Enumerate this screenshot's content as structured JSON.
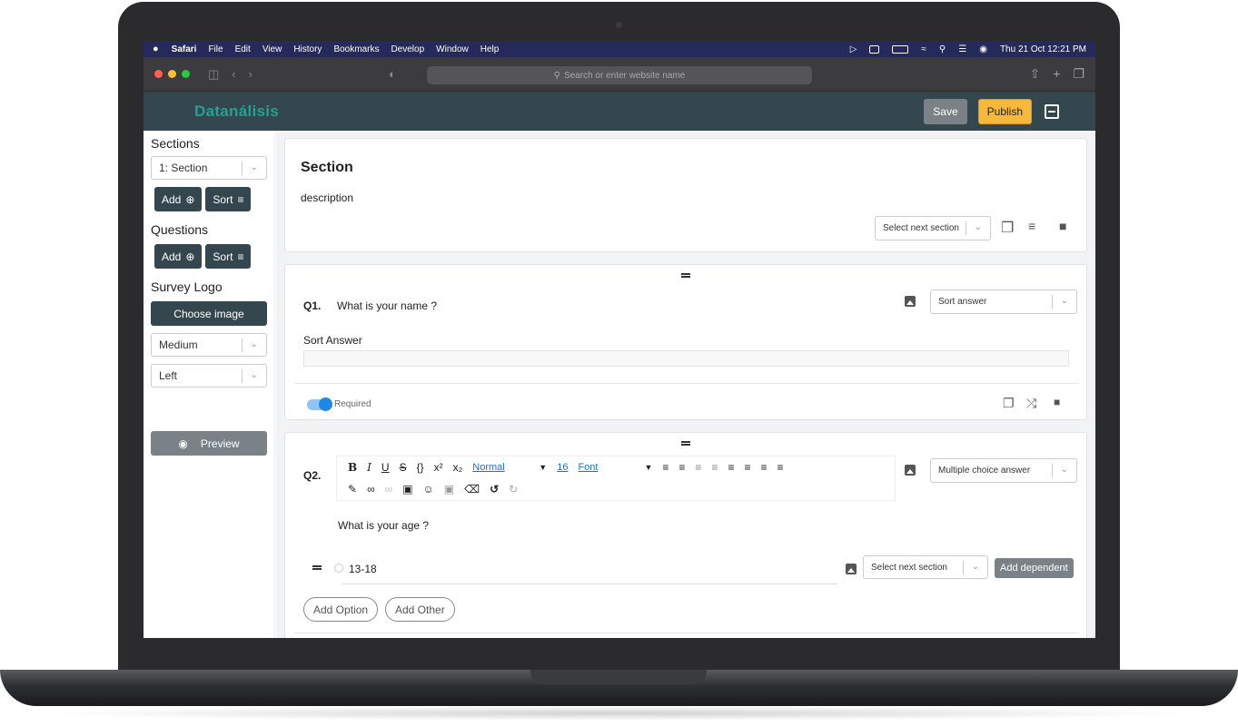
{
  "menubar": {
    "apple": "",
    "items": [
      "Safari",
      "File",
      "Edit",
      "View",
      "History",
      "Bookmarks",
      "Develop",
      "Window",
      "Help"
    ],
    "datetime": "Thu 21 Oct  12:21 PM"
  },
  "browser": {
    "url_placeholder": "Search or enter website name"
  },
  "app": {
    "brand": "Datanálisis",
    "save_label": "Save",
    "publish_label": "Publish"
  },
  "sidebar": {
    "sections_heading": "Sections",
    "section_select": "1: Section",
    "add_label": "Add",
    "sort_label": "Sort",
    "questions_heading": "Questions",
    "q_add_label": "Add",
    "q_sort_label": "Sort",
    "logo_heading": "Survey Logo",
    "choose_image_label": "Choose image",
    "size_select": "Medium",
    "align_select": "Left",
    "preview_label": "Preview"
  },
  "section_card": {
    "title": "Section",
    "description": "description",
    "next_section_select": "Select next section"
  },
  "q1": {
    "number": "Q1.",
    "text": "What is your name ?",
    "type_select": "Sort answer",
    "answer_label": "Sort Answer",
    "required_label": "Required"
  },
  "q2": {
    "number": "Q2.",
    "text": "What is your age ?",
    "type_select": "Multiple choice answer",
    "editor": {
      "bold": "B",
      "italic": "I",
      "underline": "U",
      "strike": "S",
      "code": "{}",
      "superscript": "x²",
      "subscript": "x₂",
      "heading": "Normal",
      "size": "16",
      "font": "Font"
    },
    "option_1": "13-18",
    "option_next_section": "Select next section",
    "add_dependent_label": "Add dependent",
    "add_option_label": "Add Option",
    "add_other_label": "Add Other"
  },
  "colors": {
    "header": "#34474f",
    "brand": "#1fa58f",
    "publish": "#f6b93b",
    "toggle": "#1e88e5"
  }
}
